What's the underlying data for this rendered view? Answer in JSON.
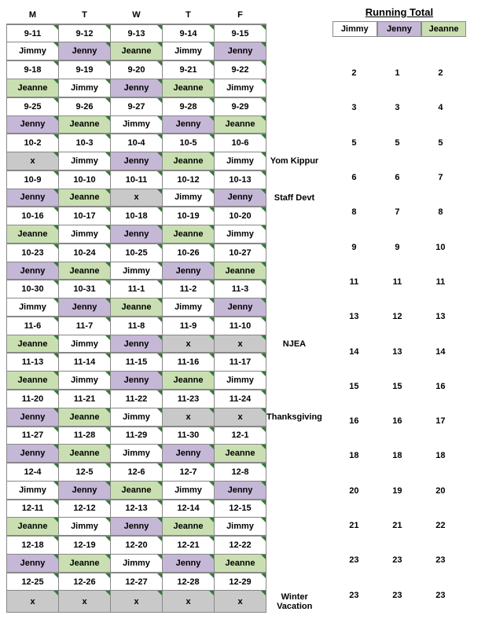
{
  "weekday_header": [
    "M",
    "T",
    "W",
    "T",
    "F"
  ],
  "running_total": {
    "title": "Running Total",
    "headers": [
      "Jimmy",
      "Jenny",
      "Jeanne"
    ],
    "rows": [
      [
        2,
        1,
        2
      ],
      [
        3,
        3,
        4
      ],
      [
        5,
        5,
        5
      ],
      [
        6,
        6,
        7
      ],
      [
        8,
        7,
        8
      ],
      [
        9,
        9,
        10
      ],
      [
        11,
        11,
        11
      ],
      [
        13,
        12,
        13
      ],
      [
        14,
        13,
        14
      ],
      [
        15,
        15,
        16
      ],
      [
        16,
        16,
        17
      ],
      [
        18,
        18,
        18
      ],
      [
        20,
        19,
        20
      ],
      [
        21,
        21,
        22
      ],
      [
        23,
        23,
        23
      ],
      [
        23,
        23,
        23
      ]
    ]
  },
  "weeks": [
    {
      "dates": [
        "9-11",
        "9-12",
        "9-13",
        "9-14",
        "9-15"
      ],
      "date_classes": [
        "blue-date",
        "",
        "",
        "",
        ""
      ],
      "names": [
        "Jimmy",
        "Jenny",
        "Jeanne",
        "Jimmy",
        "Jenny"
      ],
      "note": ""
    },
    {
      "dates": [
        "9-18",
        "9-19",
        "9-20",
        "9-21",
        "9-22"
      ],
      "names": [
        "Jeanne",
        "Jimmy",
        "Jenny",
        "Jeanne",
        "Jimmy"
      ],
      "note": ""
    },
    {
      "dates": [
        "9-25",
        "9-26",
        "9-27",
        "9-28",
        "9-29"
      ],
      "names": [
        "Jenny",
        "Jeanne",
        "Jimmy",
        "Jenny",
        "Jeanne"
      ],
      "note": ""
    },
    {
      "dates": [
        "10-2",
        "10-3",
        "10-4",
        "10-5",
        "10-6"
      ],
      "names": [
        "x",
        "Jimmy",
        "Jenny",
        "Jeanne",
        "Jimmy"
      ],
      "note": "Yom Kippur"
    },
    {
      "dates": [
        "10-9",
        "10-10",
        "10-11",
        "10-12",
        "10-13"
      ],
      "names": [
        "Jenny",
        "Jeanne",
        "x",
        "Jimmy",
        "Jenny"
      ],
      "note": "Staff Devt"
    },
    {
      "dates": [
        "10-16",
        "10-17",
        "10-18",
        "10-19",
        "10-20"
      ],
      "names": [
        "Jeanne",
        "Jimmy",
        "Jenny",
        "Jeanne",
        "Jimmy"
      ],
      "note": ""
    },
    {
      "dates": [
        "10-23",
        "10-24",
        "10-25",
        "10-26",
        "10-27"
      ],
      "names": [
        "Jenny",
        "Jeanne",
        "Jimmy",
        "Jenny",
        "Jeanne"
      ],
      "note": ""
    },
    {
      "dates": [
        "10-30",
        "10-31",
        "11-1",
        "11-2",
        "11-3"
      ],
      "names": [
        "Jimmy",
        "Jenny",
        "Jeanne",
        "Jimmy",
        "Jenny"
      ],
      "note": ""
    },
    {
      "dates": [
        "11-6",
        "11-7",
        "11-8",
        "11-9",
        "11-10"
      ],
      "names": [
        "Jeanne",
        "Jimmy",
        "Jenny",
        "x",
        "x"
      ],
      "note": "NJEA"
    },
    {
      "dates": [
        "11-13",
        "11-14",
        "11-15",
        "11-16",
        "11-17"
      ],
      "names": [
        "Jeanne",
        "Jimmy",
        "Jenny",
        "Jeanne",
        "Jimmy"
      ],
      "note": ""
    },
    {
      "dates": [
        "11-20",
        "11-21",
        "11-22",
        "11-23",
        "11-24"
      ],
      "names": [
        "Jenny",
        "Jeanne",
        "Jimmy",
        "x",
        "x"
      ],
      "note": "Thanksgiving"
    },
    {
      "dates": [
        "11-27",
        "11-28",
        "11-29",
        "11-30",
        "12-1"
      ],
      "names": [
        "Jenny",
        "Jeanne",
        "Jimmy",
        "Jenny",
        "Jeanne"
      ],
      "note": ""
    },
    {
      "dates": [
        "12-4",
        "12-5",
        "12-6",
        "12-7",
        "12-8"
      ],
      "names": [
        "Jimmy",
        "Jenny",
        "Jeanne",
        "Jimmy",
        "Jenny"
      ],
      "note": ""
    },
    {
      "dates": [
        "12-11",
        "12-12",
        "12-13",
        "12-14",
        "12-15"
      ],
      "names": [
        "Jeanne",
        "Jimmy",
        "Jenny",
        "Jeanne",
        "Jimmy"
      ],
      "note": ""
    },
    {
      "dates": [
        "12-18",
        "12-19",
        "12-20",
        "12-21",
        "12-22"
      ],
      "names": [
        "Jenny",
        "Jeanne",
        "Jimmy",
        "Jenny",
        "Jeanne"
      ],
      "note": ""
    },
    {
      "dates": [
        "12-25",
        "12-26",
        "12-27",
        "12-28",
        "12-29"
      ],
      "names": [
        "x",
        "x",
        "x",
        "x",
        "x"
      ],
      "note": "Winter Vacation"
    }
  ]
}
